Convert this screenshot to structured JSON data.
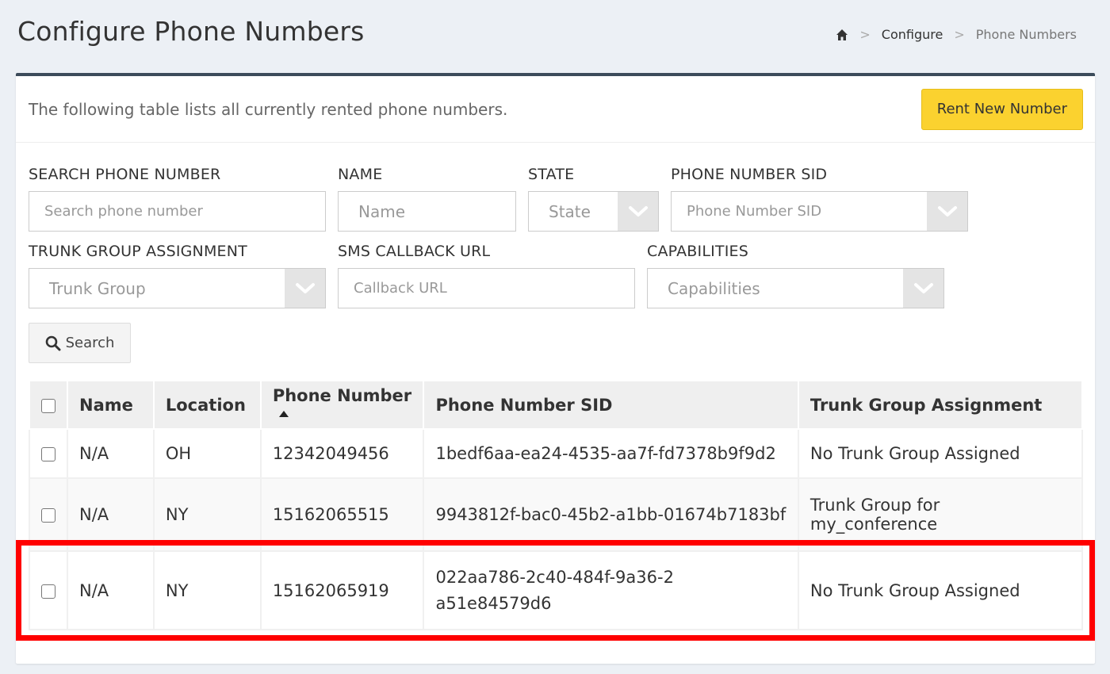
{
  "header": {
    "title": "Configure Phone Numbers",
    "breadcrumb": {
      "sep": ">",
      "configure": "Configure",
      "current": "Phone Numbers"
    }
  },
  "box": {
    "description": "The following table lists all currently rented phone numbers.",
    "rent_button": "Rent New Number"
  },
  "filters": {
    "search_phone": {
      "label": "SEARCH PHONE NUMBER",
      "placeholder": "Search phone number"
    },
    "name": {
      "label": "NAME",
      "placeholder": "Name"
    },
    "state": {
      "label": "STATE",
      "placeholder": "State"
    },
    "sid": {
      "label": "PHONE NUMBER SID",
      "placeholder": "Phone Number SID"
    },
    "trunk": {
      "label": "TRUNK GROUP ASSIGNMENT",
      "placeholder": "Trunk Group"
    },
    "sms": {
      "label": "SMS CALLBACK URL",
      "placeholder": "Callback URL"
    },
    "capabilities": {
      "label": "CAPABILITIES",
      "placeholder": "Capabilities"
    },
    "search_button": "Search"
  },
  "table": {
    "columns": [
      "Name",
      "Location",
      "Phone Number",
      "Phone Number SID",
      "Trunk Group Assignment"
    ],
    "rows": [
      {
        "name": "N/A",
        "location": "OH",
        "phone": "12342049456",
        "sid": "1bedf6aa-ea24-4535-aa7f-fd7378b9f9d2",
        "trunk": "No Trunk Group Assigned"
      },
      {
        "name": "N/A",
        "location": "NY",
        "phone": "15162065515",
        "sid": "9943812f-bac0-45b2-a1bb-01674b7183bf",
        "trunk": "Trunk Group for my_conference"
      },
      {
        "name": "N/A",
        "location": "NY",
        "phone": "15162065919",
        "sid": "022aa786-2c40-484f-9a36-2a51e84579d6",
        "trunk": "No Trunk Group Assigned"
      }
    ]
  },
  "colors": {
    "accent": "#fbd22f",
    "highlight": "#ff0000",
    "box_border": "#3c4b5a"
  }
}
